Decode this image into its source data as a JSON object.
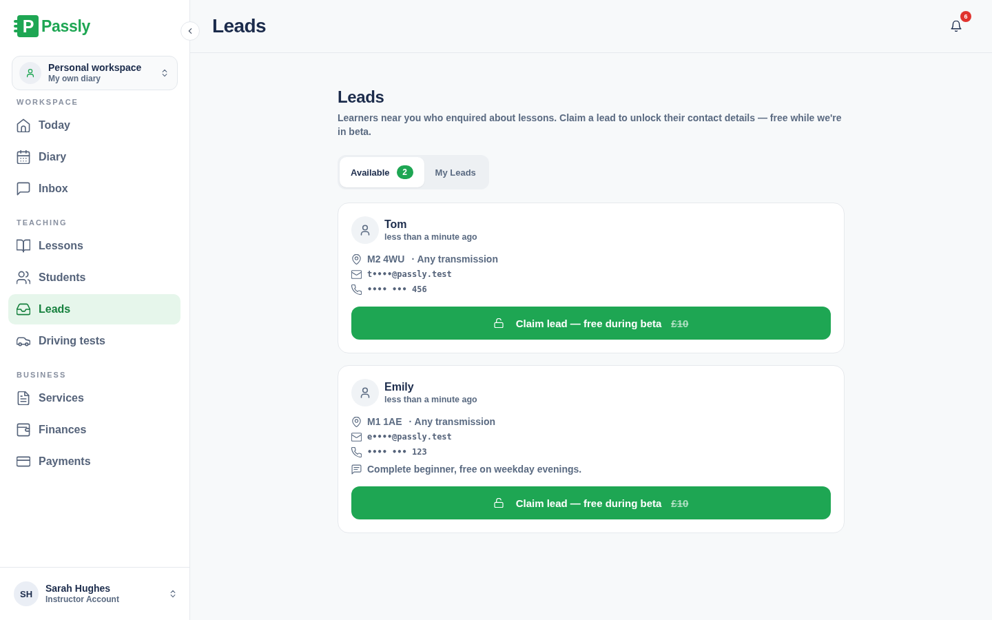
{
  "brand": {
    "mark": "P",
    "name": "Passly"
  },
  "sidebar": {
    "workspace": {
      "title": "Personal workspace",
      "subtitle": "My own diary"
    },
    "sections": [
      {
        "label": "WORKSPACE",
        "items": [
          {
            "label": "Today",
            "selected": false
          },
          {
            "label": "Diary",
            "selected": false
          },
          {
            "label": "Inbox",
            "selected": false
          }
        ]
      },
      {
        "label": "TEACHING",
        "items": [
          {
            "label": "Lessons",
            "selected": false
          },
          {
            "label": "Students",
            "selected": false
          },
          {
            "label": "Leads",
            "selected": true
          },
          {
            "label": "Driving tests",
            "selected": false
          }
        ]
      },
      {
        "label": "BUSINESS",
        "items": [
          {
            "label": "Services",
            "selected": false
          },
          {
            "label": "Finances",
            "selected": false
          },
          {
            "label": "Payments",
            "selected": false
          }
        ]
      }
    ],
    "user": {
      "initials": "SH",
      "name": "Sarah Hughes",
      "role": "Instructor Account"
    }
  },
  "header": {
    "title": "Leads",
    "notification_count": "6"
  },
  "page": {
    "title": "Leads",
    "description": "Learners near you who enquired about lessons. Claim a lead to unlock their contact details — free while we're in beta.",
    "tabs": [
      {
        "label": "Available",
        "count": "2",
        "selected": true
      },
      {
        "label": "My Leads",
        "selected": false
      }
    ],
    "leads": [
      {
        "name": "Tom",
        "time": "less than a minute ago",
        "postcode": "M2 4WU",
        "transmission": "· Any transmission",
        "email": "t••••@passly.test",
        "phone": "•••• ••• 456",
        "claim_button": {
          "label": "Claim lead — free during beta",
          "old_price": "£10"
        }
      },
      {
        "name": "Emily",
        "time": "less than a minute ago",
        "postcode": "M1 1AE",
        "transmission": "· Any transmission",
        "email": "e••••@passly.test",
        "phone": "•••• ••• 123",
        "note": "Complete beginner, free on weekday evenings.",
        "claim_button": {
          "label": "Claim lead — free during beta",
          "old_price": "£10"
        }
      }
    ]
  }
}
